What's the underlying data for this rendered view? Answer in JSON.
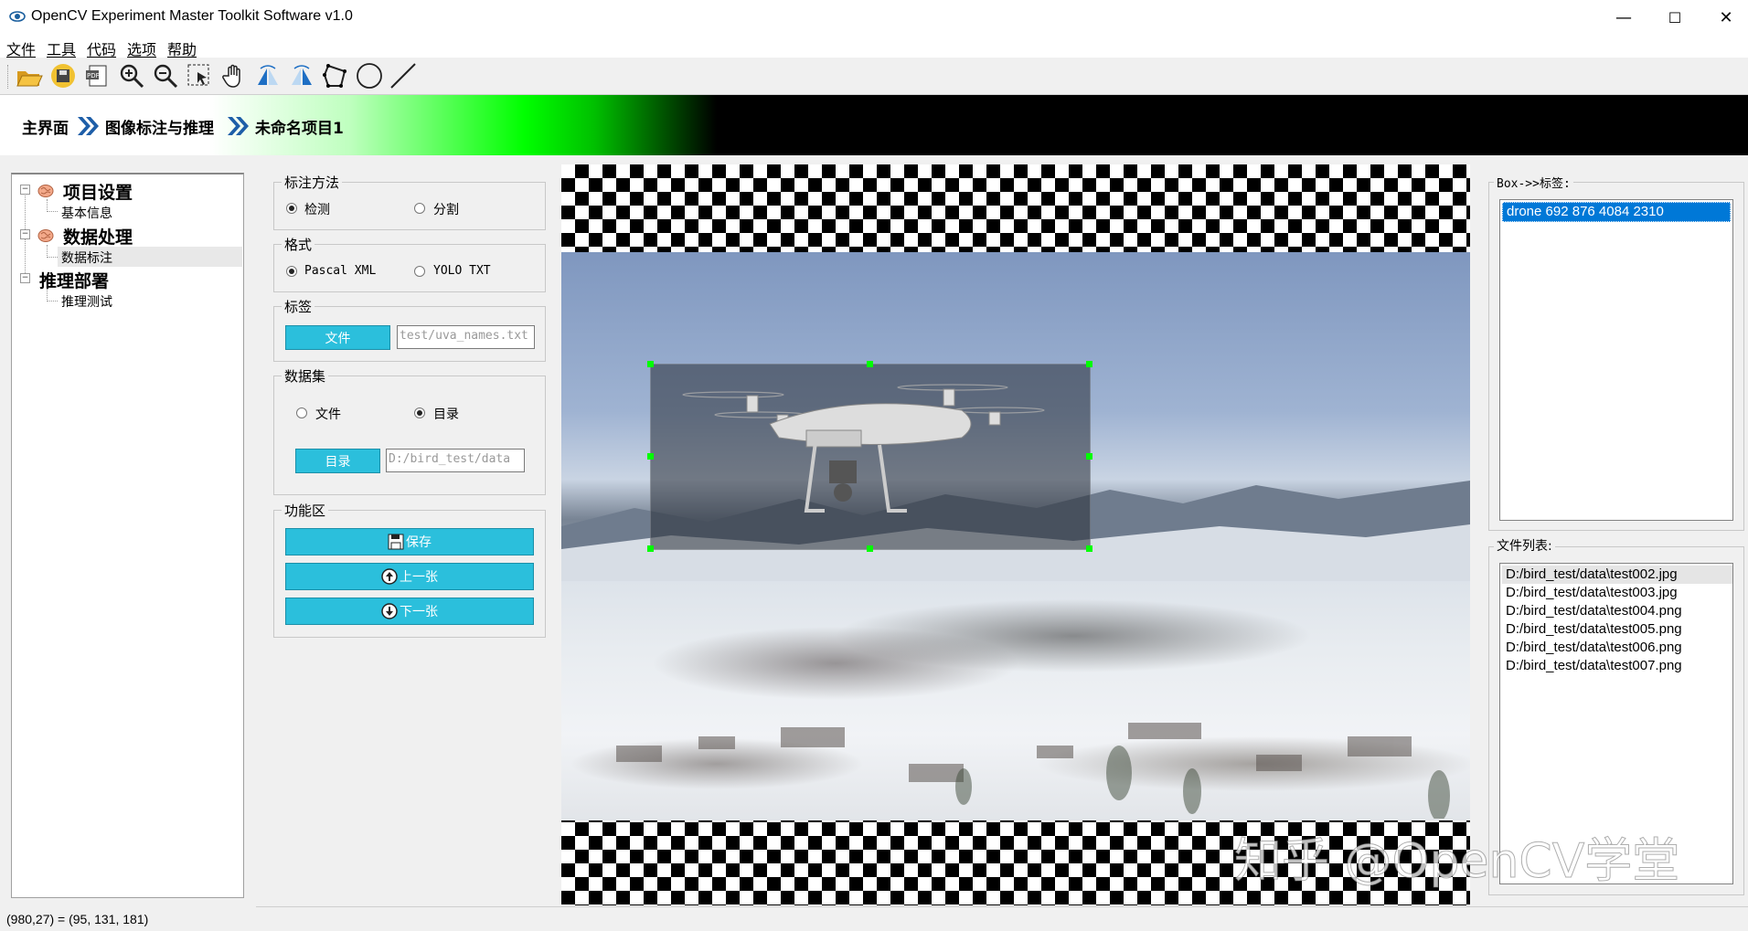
{
  "window": {
    "title": "OpenCV Experiment Master Toolkit Software v1.0",
    "controls": {
      "minimize": "—",
      "maximize": "☐",
      "close": "✕"
    }
  },
  "menu": [
    "文件",
    "工具",
    "代码",
    "选项",
    "帮助"
  ],
  "toolbar": [
    "open-folder-icon",
    "save-icon",
    "export-icon",
    "zoom-in-icon",
    "zoom-out-icon",
    "select-region-icon",
    "pan-hand-icon",
    "flip-left-icon",
    "flip-right-icon",
    "polygon-icon",
    "circle-icon",
    "line-icon"
  ],
  "breadcrumb": [
    "主界面",
    "图像标注与推理",
    "未命名项目1"
  ],
  "tree": {
    "groups": [
      {
        "label": "项目设置",
        "children": [
          "基本信息"
        ]
      },
      {
        "label": "数据处理",
        "children": [
          "数据标注"
        ]
      },
      {
        "label": "推理部署",
        "children": [
          "推理测试"
        ]
      }
    ],
    "selected": "数据标注"
  },
  "annotation_method": {
    "title": "标注方法",
    "options": [
      "检测",
      "分割"
    ],
    "selected": "检测"
  },
  "format": {
    "title": "格式",
    "options": [
      "Pascal XML",
      "YOLO TXT"
    ],
    "selected": "Pascal XML"
  },
  "label": {
    "title": "标签",
    "button": "文件",
    "path": "test/uva_names.txt"
  },
  "dataset": {
    "title": "数据集",
    "options": [
      "文件",
      "目录"
    ],
    "selected": "目录",
    "button": "目录",
    "path": "D:/bird_test/data"
  },
  "functions": {
    "title": "功能区",
    "save": "保存",
    "prev": "上一张",
    "next": "下一张"
  },
  "box_labels": {
    "title": "Box->>标签:",
    "items": [
      "drone 692 876 4084 2310"
    ]
  },
  "file_list": {
    "title": "文件列表:",
    "items": [
      "D:/bird_test/data\\test002.jpg",
      "D:/bird_test/data\\test003.jpg",
      "D:/bird_test/data\\test004.png",
      "D:/bird_test/data\\test005.png",
      "D:/bird_test/data\\test006.png",
      "D:/bird_test/data\\test007.png"
    ]
  },
  "status": "(980,27) = (95, 131, 181)",
  "watermark": "知乎 @OpenCV学堂",
  "colors": {
    "accent_button": "#2bbfdc",
    "selection": "#0078d7",
    "handle": "#00ff00"
  }
}
